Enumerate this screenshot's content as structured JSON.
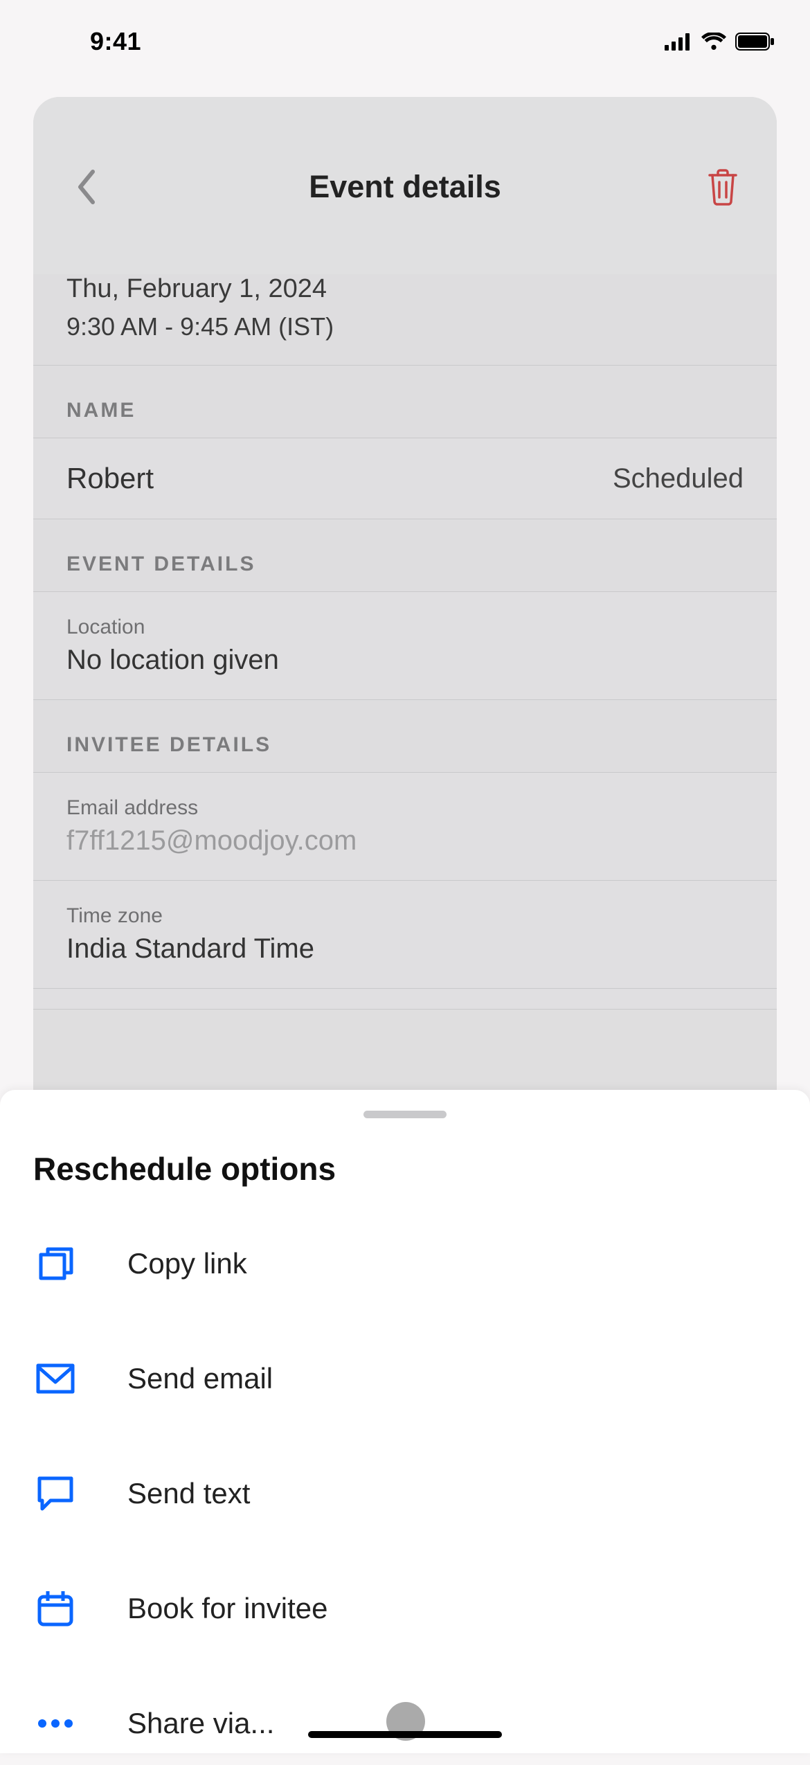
{
  "status_bar": {
    "time": "9:41"
  },
  "modal": {
    "title": "Event details",
    "date_line": "Thu, February 1, 2024",
    "time_line": "9:30 AM - 9:45 AM (IST)",
    "sections": {
      "name": {
        "header": "NAME",
        "value": "Robert",
        "status": "Scheduled"
      },
      "event_details": {
        "header": "EVENT DETAILS",
        "location": {
          "label": "Location",
          "value": "No location given"
        }
      },
      "invitee_details": {
        "header": "INVITEE DETAILS",
        "email": {
          "label": "Email address",
          "value": "f7ff1215@moodjoy.com"
        },
        "timezone": {
          "label": "Time zone",
          "value": "India Standard Time"
        }
      }
    }
  },
  "sheet": {
    "title": "Reschedule options",
    "options": {
      "copy_link": "Copy link",
      "send_email": "Send email",
      "send_text": "Send text",
      "book_for_invitee": "Book for invitee",
      "share_via": "Share via..."
    }
  },
  "colors": {
    "accent": "#0a66ff",
    "danger": "#c84545"
  }
}
